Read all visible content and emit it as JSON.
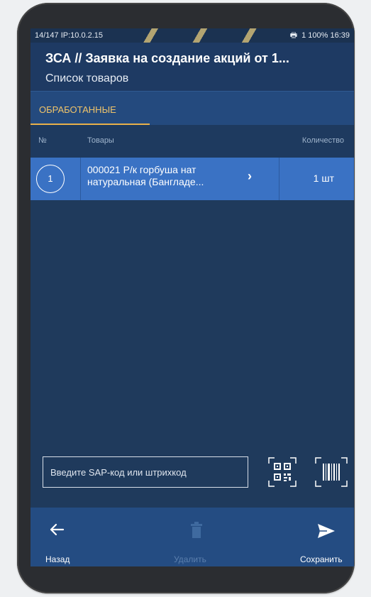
{
  "status_bar": {
    "left_text": "14/147 IP:10.0.2.15",
    "right_text": "1  100%  16:39"
  },
  "app": {
    "title": "ЗСА // Заявка на создание акций от 1...",
    "subtitle": "Список товаров"
  },
  "tabs": [
    {
      "label": "ОБРАБОТАННЫЕ",
      "active": true
    }
  ],
  "table": {
    "columns": [
      "№",
      "Товары",
      "Количество"
    ],
    "rows": [
      {
        "number": "1",
        "name_line1": "000021 Р/к горбуша нат",
        "name_line2": "натуральная (Бангладе...",
        "quantity": "1 шт"
      }
    ]
  },
  "search": {
    "placeholder": "Введите SAP-код или штрихкод",
    "value": ""
  },
  "bottom_bar": {
    "back_label": "Назад",
    "delete_label": "Удалить",
    "save_label": "Сохранить"
  },
  "colors": {
    "accent": "#f0c46a",
    "background": "#1f3a5c",
    "row_highlight": "#3a72c4",
    "bottom_bar": "#244c82"
  },
  "icons": [
    "back-arrow-icon",
    "trash-icon",
    "send-icon",
    "qr-code-icon",
    "barcode-icon",
    "chevron-right-icon"
  ]
}
